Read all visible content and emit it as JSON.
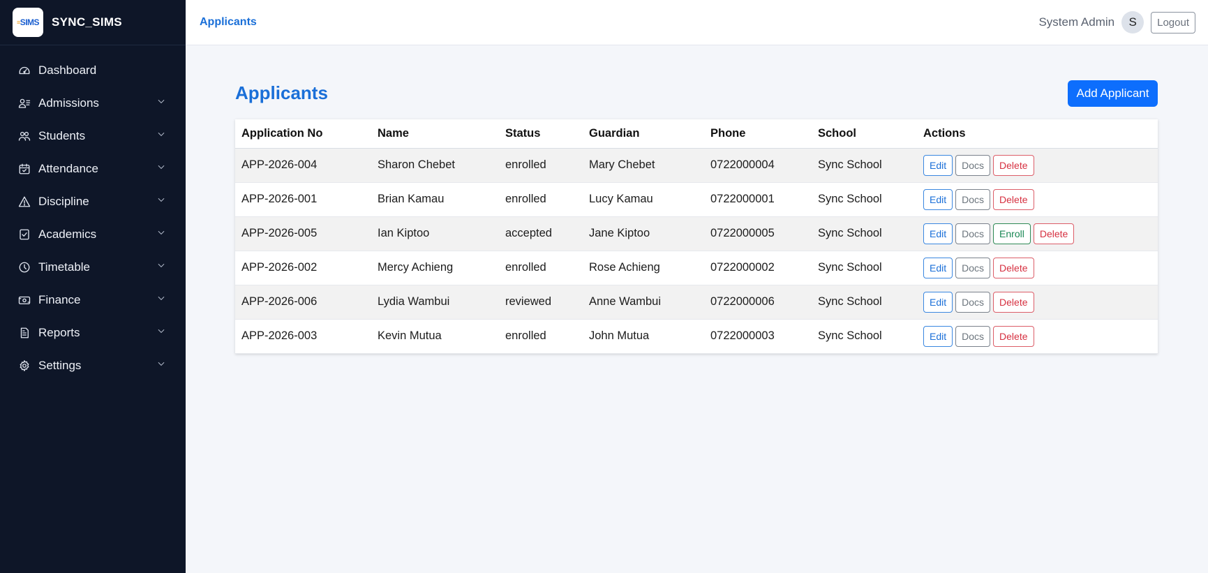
{
  "brand": {
    "logo_text": "SIMS",
    "name": "SYNC_SIMS"
  },
  "sidebar": {
    "items": [
      {
        "label": "Dashboard",
        "icon": "dashboard-icon",
        "expandable": false
      },
      {
        "label": "Admissions",
        "icon": "user-list-icon",
        "expandable": true
      },
      {
        "label": "Students",
        "icon": "users-icon",
        "expandable": true
      },
      {
        "label": "Attendance",
        "icon": "calendar-check-icon",
        "expandable": true
      },
      {
        "label": "Discipline",
        "icon": "warning-icon",
        "expandable": true
      },
      {
        "label": "Academics",
        "icon": "checkbox-icon",
        "expandable": true
      },
      {
        "label": "Timetable",
        "icon": "clock-icon",
        "expandable": true
      },
      {
        "label": "Finance",
        "icon": "cash-icon",
        "expandable": true
      },
      {
        "label": "Reports",
        "icon": "report-icon",
        "expandable": true
      },
      {
        "label": "Settings",
        "icon": "gear-icon",
        "expandable": true
      }
    ]
  },
  "topbar": {
    "breadcrumb": "Applicants",
    "user_name": "System Admin",
    "avatar_initial": "S",
    "logout_label": "Logout"
  },
  "main": {
    "title": "Applicants",
    "add_button": "Add Applicant",
    "table": {
      "headers": [
        "Application No",
        "Name",
        "Status",
        "Guardian",
        "Phone",
        "School",
        "Actions"
      ],
      "rows": [
        {
          "app_no": "APP-2026-004",
          "name": "Sharon Chebet",
          "status": "enrolled",
          "guardian": "Mary Chebet",
          "phone": "0722000004",
          "school": "Sync School",
          "actions": [
            "Edit",
            "Docs",
            "Delete"
          ]
        },
        {
          "app_no": "APP-2026-001",
          "name": "Brian Kamau",
          "status": "enrolled",
          "guardian": "Lucy Kamau",
          "phone": "0722000001",
          "school": "Sync School",
          "actions": [
            "Edit",
            "Docs",
            "Delete"
          ]
        },
        {
          "app_no": "APP-2026-005",
          "name": "Ian Kiptoo",
          "status": "accepted",
          "guardian": "Jane Kiptoo",
          "phone": "0722000005",
          "school": "Sync School",
          "actions": [
            "Edit",
            "Docs",
            "Enroll",
            "Delete"
          ]
        },
        {
          "app_no": "APP-2026-002",
          "name": "Mercy Achieng",
          "status": "enrolled",
          "guardian": "Rose Achieng",
          "phone": "0722000002",
          "school": "Sync School",
          "actions": [
            "Edit",
            "Docs",
            "Delete"
          ]
        },
        {
          "app_no": "APP-2026-006",
          "name": "Lydia Wambui",
          "status": "reviewed",
          "guardian": "Anne Wambui",
          "phone": "0722000006",
          "school": "Sync School",
          "actions": [
            "Edit",
            "Docs",
            "Delete"
          ]
        },
        {
          "app_no": "APP-2026-003",
          "name": "Kevin Mutua",
          "status": "enrolled",
          "guardian": "John Mutua",
          "phone": "0722000003",
          "school": "Sync School",
          "actions": [
            "Edit",
            "Docs",
            "Delete"
          ]
        }
      ]
    }
  },
  "colors": {
    "sidebar_bg": "#0e1628",
    "accent": "#1a6fd8",
    "primary_button": "#0d6efd",
    "danger": "#d63040",
    "success": "#198754"
  }
}
